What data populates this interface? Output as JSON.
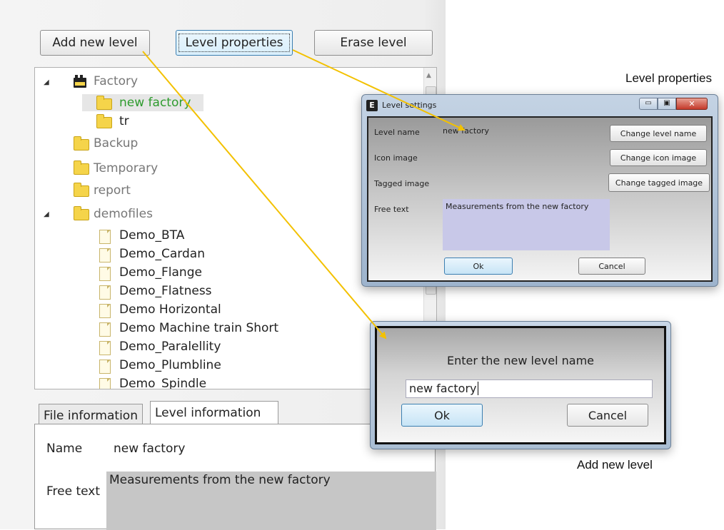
{
  "toolbar": {
    "add_level": "Add new level",
    "level_properties": "Level properties",
    "erase_level": "Erase level"
  },
  "tree": {
    "nodes": [
      {
        "label": "Factory",
        "icon": "factory-icon",
        "color": "#777777"
      },
      {
        "label": "new factory",
        "icon": "folder-icon",
        "color": "#2e9b2e"
      },
      {
        "label": "tr",
        "icon": "folder-icon",
        "color": "#222222"
      },
      {
        "label": "Backup",
        "icon": "folder-icon",
        "color": "#777777"
      },
      {
        "label": "Temporary",
        "icon": "folder-icon",
        "color": "#777777"
      },
      {
        "label": "report",
        "icon": "folder-icon",
        "color": "#777777"
      },
      {
        "label": "demofiles",
        "icon": "folder-icon",
        "color": "#777777"
      },
      {
        "label": "Demo_BTA",
        "icon": "document-icon"
      },
      {
        "label": "Demo_Cardan",
        "icon": "document-icon"
      },
      {
        "label": "Demo_Flange",
        "icon": "document-icon"
      },
      {
        "label": "Demo_Flatness",
        "icon": "document-icon"
      },
      {
        "label": "Demo Horizontal",
        "icon": "document-icon"
      },
      {
        "label": "Demo Machine train Short",
        "icon": "document-icon"
      },
      {
        "label": "Demo_Paralellity",
        "icon": "document-icon"
      },
      {
        "label": "Demo_Plumbline",
        "icon": "document-icon"
      },
      {
        "label": "Demo_Spindle",
        "icon": "document-icon"
      }
    ]
  },
  "tabs": {
    "file_info": "File information",
    "level_info": "Level information"
  },
  "level_info": {
    "name_label": "Name",
    "name_value": "new factory",
    "free_text_label": "Free text",
    "free_text_value": "Measurements from the new factory"
  },
  "settings_dialog": {
    "title": "Level settings",
    "level_name_label": "Level name",
    "level_name_value": "new factory",
    "icon_image_label": "Icon image",
    "tagged_image_label": "Tagged image",
    "free_text_label": "Free text",
    "free_text_value": "Measurements from the new factory",
    "change_name_btn": "Change level name",
    "change_icon_btn": "Change icon image",
    "change_tagged_btn": "Change tagged image",
    "ok": "Ok",
    "cancel": "Cancel"
  },
  "new_level_dialog": {
    "prompt": "Enter the new level name",
    "input_value": "new factory",
    "ok": "Ok",
    "cancel": "Cancel"
  },
  "captions": {
    "level_properties": "Level properties",
    "add_new_level": "Add new level"
  },
  "colors": {
    "arrow": "#f3c100",
    "selected_text": "#2e9b2e",
    "free_text_bg": "#c8c8e8"
  }
}
